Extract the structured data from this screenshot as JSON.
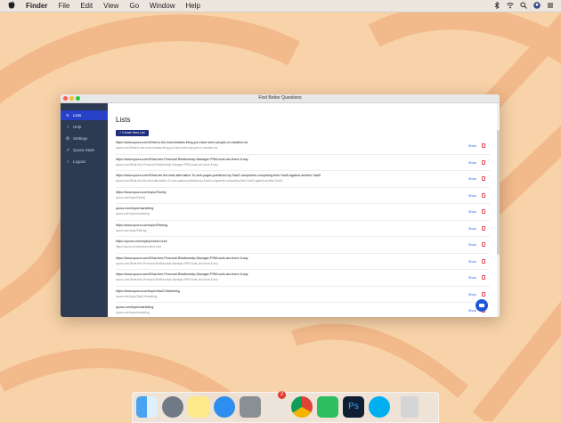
{
  "menubar": {
    "apple_icon": "apple-icon",
    "items": [
      "Finder",
      "File",
      "Edit",
      "View",
      "Go",
      "Window",
      "Help"
    ],
    "status_icons": [
      "bluetooth-icon",
      "wifi-icon",
      "search-icon",
      "user-icon",
      "list-icon"
    ]
  },
  "window": {
    "title": "Find Better Questions",
    "heading": "Lists",
    "create_button_label": "+ Create New List"
  },
  "sidebar": {
    "items": [
      {
        "label": "Lists",
        "icon": "list-icon"
      },
      {
        "label": "Help",
        "icon": "help-icon"
      },
      {
        "label": "Settings",
        "icon": "settings-icon"
      },
      {
        "label": "Quora Stats",
        "icon": "stats-icon"
      },
      {
        "label": "Logout",
        "icon": "logout-icon"
      }
    ]
  },
  "lists": [
    {
      "url": "https://www.quora.com/What-is-the-most-badass-thing-you-have-seen-people-on-vacation-do",
      "sub": "quora.com/What-is-the-most-badass-thing-you-have-seen-people-on-vacation-do"
    },
    {
      "url": "https://www.quora.com/What-free-Personal-Relationship-Manager-PRM-tools-are-there-if-any",
      "sub": "quora.com/What-free-Personal-Relationship-Manager-PRM-tools-are-there-if-any"
    },
    {
      "url": "https://www.quora.com/What-are-the-best-alternative-To-web-pages-published-by-SaaS-companies-comparing-their-SaaS-against-another-SaaS",
      "sub": "quora.com/What-are-the-best-alternative-To-web-pages-published-by-SaaS-companies-comparing-their-SaaS-against-another-SaaS"
    },
    {
      "url": "https://www.quora.com/topic/Family",
      "sub": "quora.com/topic/Family"
    },
    {
      "url": "quora.com/topic/marketing",
      "sub": "quora.com/topic/marketing"
    },
    {
      "url": "https://www.quora.com/topic/Parking",
      "sub": "quora.com/topic/Parking"
    },
    {
      "url": "https://quora.com/topic/product-hunt",
      "sub": "https://quora.com/topic/product-hunt"
    },
    {
      "url": "https://www.quora.com/What-free-Personal-Relationship-Manager-PRM-tools-are-there-if-any",
      "sub": "quora.com/What-free-Personal-Relationship-Manager-PRM-tools-are-there-if-any"
    },
    {
      "url": "https://www.quora.com/What-free-Personal-Relationship-Manager-PRM-tools-are-there-if-any",
      "sub": "quora.com/What-free-Personal-Relationship-Manager-PRM-tools-are-there-if-any"
    },
    {
      "url": "https://www.quora.com/topic/SaaS-Marketing",
      "sub": "quora.com/topic/SaaS-Marketing"
    },
    {
      "url": "quora.com/topic/marketing",
      "sub": "quora.com/topic/marketing"
    }
  ],
  "row_action_label": "Show",
  "colors": {
    "sidebar": "#2c3a52",
    "active": "#2741c9",
    "create_button": "#1e2d7c",
    "link": "#2c5fd6",
    "delete": "#e24a4a",
    "chat": "#1e58d6"
  },
  "dock": {
    "apps": [
      "finder-icon",
      "launchpad-icon",
      "notes-icon",
      "app-store-icon",
      "system-preferences-icon",
      "calendar-app-icon",
      "chrome-icon",
      "evernote-icon",
      "photoshop-icon",
      "skype-icon",
      "trash-icon"
    ],
    "badge": "2",
    "photoshop_label": "Ps"
  }
}
